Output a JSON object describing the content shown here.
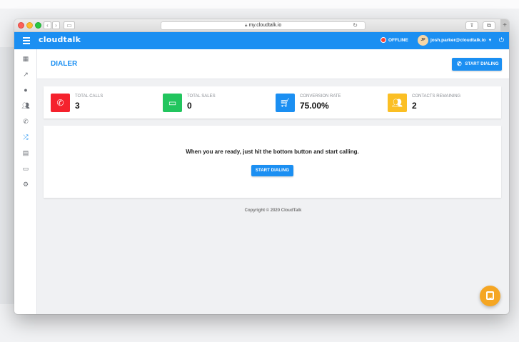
{
  "browser": {
    "url": "my.cloudtalk.io",
    "lock_icon": "lock-icon",
    "reload_icon": "reload-icon"
  },
  "header": {
    "logo": "cloudtalk",
    "status": "OFFLINE",
    "avatar_initials": "JP",
    "user_email": "josh.parker@cloudtalk.io",
    "brand_color": "#1b8ff2"
  },
  "sidebar": {
    "items": [
      {
        "icon": "dashboard-icon"
      },
      {
        "icon": "analytics-icon"
      },
      {
        "icon": "user-icon"
      },
      {
        "icon": "contacts-icon"
      },
      {
        "icon": "phone-icon"
      },
      {
        "icon": "dialer-icon",
        "active": true
      },
      {
        "icon": "campaigns-icon"
      },
      {
        "icon": "card-icon"
      },
      {
        "icon": "settings-icon"
      }
    ]
  },
  "page": {
    "title": "DIALER",
    "start_button": "START DIALING"
  },
  "stats": [
    {
      "label": "TOTAL CALLS",
      "value": "3",
      "icon": "phone-icon",
      "color": "#f5222d"
    },
    {
      "label": "TOTAL SALES",
      "value": "0",
      "icon": "credit-card-icon",
      "color": "#22c55e"
    },
    {
      "label": "CONVERSION RATE",
      "value": "75.00%",
      "icon": "cart-icon",
      "color": "#1b8ff2"
    },
    {
      "label": "CONTACTS REMAINING",
      "value": "2",
      "icon": "group-icon",
      "color": "#fbbf24"
    }
  ],
  "panel": {
    "message": "When you are ready, just hit the bottom button and start calling.",
    "button": "START DIALING"
  },
  "footer": {
    "copyright": "Copyright © 2020 CloudTalk"
  }
}
